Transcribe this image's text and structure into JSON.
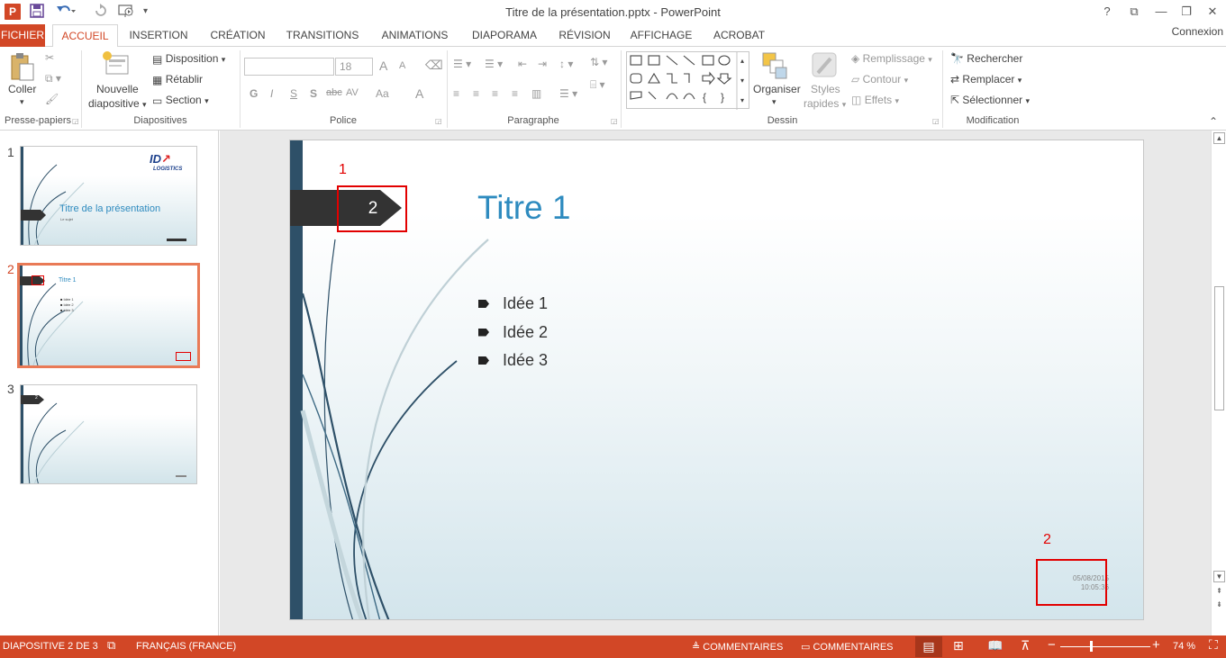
{
  "app": {
    "window_title": "Titre de la présentation.pptx - PowerPoint",
    "icon_letter": "P",
    "window_controls": [
      "?",
      "⧉",
      "—",
      "❐",
      "✕"
    ]
  },
  "tabs": [
    {
      "label": "FICHIER"
    },
    {
      "label": "ACCUEIL"
    },
    {
      "label": "INSERTION"
    },
    {
      "label": "CRÉATION"
    },
    {
      "label": "TRANSITIONS"
    },
    {
      "label": "ANIMATIONS"
    },
    {
      "label": "DIAPORAMA"
    },
    {
      "label": "RÉVISION"
    },
    {
      "label": "AFFICHAGE"
    },
    {
      "label": "ACROBAT"
    }
  ],
  "account": "Connexion",
  "ribbon": {
    "clipboard": {
      "paste": "Coller",
      "label": "Presse-papiers"
    },
    "slides": {
      "new_slide_line1": "Nouvelle",
      "new_slide_line2": "diapositive",
      "layout": "Disposition",
      "reset": "Rétablir",
      "section": "Section",
      "label": "Diapositives"
    },
    "font": {
      "font_name": "",
      "font_size": "18",
      "bold": "G",
      "italic": "I",
      "underline": "S",
      "shadow": "S",
      "strike": "abc",
      "spacing": "AV",
      "case": "Aa",
      "color": "A",
      "grow": "A",
      "shrink": "A",
      "label": "Police"
    },
    "paragraph": {
      "label": "Paragraphe"
    },
    "drawing": {
      "arrange": "Organiser",
      "quick_styles_line1": "Styles",
      "quick_styles_line2": "rapides",
      "fill": "Remplissage",
      "outline": "Contour",
      "effects": "Effets",
      "label": "Dessin"
    },
    "editing": {
      "find": "Rechercher",
      "replace": "Remplacer",
      "select": "Sélectionner",
      "label": "Modification"
    }
  },
  "thumbnails": [
    {
      "number": "1",
      "title": "Titre de la présentation",
      "subtitle": "Le sujet",
      "logo_line1": "ID",
      "logo_line2": "LOGISTICS"
    },
    {
      "number": "2",
      "title": "Titre 1",
      "bullets": [
        "Idée 1",
        "Idée 2",
        "Idée 3"
      ],
      "tag": "2"
    },
    {
      "number": "3",
      "tag": "2"
    }
  ],
  "slide": {
    "number_tag": "2",
    "title": "Titre 1",
    "bullets": [
      "Idée 1",
      "Idée 2",
      "Idée 3"
    ],
    "date": "05/08/2015",
    "time": "10:05:36"
  },
  "annotations": {
    "label1": "1",
    "label2": "2",
    "color": "#e20000"
  },
  "statusbar": {
    "slide_info": "DIAPOSITIVE 2 DE 3",
    "language": "FRANÇAIS (FRANCE)",
    "notes": "COMMENTAIRES",
    "comments": "COMMENTAIRES",
    "zoom": "74 %",
    "minus": "−",
    "plus": "+"
  },
  "colors": {
    "accent": "#d24726",
    "slide_title": "#2e8bbf",
    "slide_bar": "#2e5068"
  }
}
